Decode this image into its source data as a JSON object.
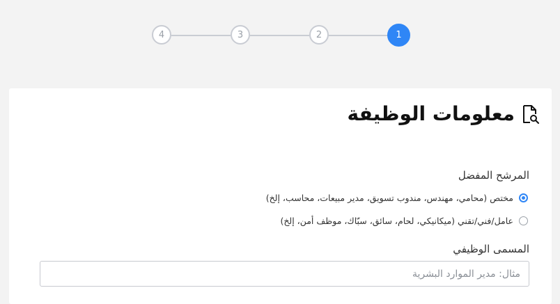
{
  "stepper": {
    "steps": [
      "1",
      "2",
      "3",
      "4"
    ],
    "active_step": "1"
  },
  "form": {
    "title": "معلومات الوظيفة",
    "title_icon": "document-search-icon",
    "candidate": {
      "label": "المرشح المفضل",
      "options": [
        {
          "label": "مختص (محامي، مهندس، مندوب تسويق، مدير مبيعات، محاسب، إلخ)",
          "checked": true
        },
        {
          "label": "عامل/فني/تقني (ميكانيكي، لحام، سائق، سبّاك، موظف أمن، إلخ)",
          "checked": false
        }
      ]
    },
    "job_title": {
      "label": "المسمى الوظيفي",
      "placeholder": "مثال: مدير الموارد البشرية",
      "value": ""
    }
  },
  "colors": {
    "accent": "#2f86f6",
    "inactive": "#c9ccd3",
    "background": "#f3f3f3"
  }
}
